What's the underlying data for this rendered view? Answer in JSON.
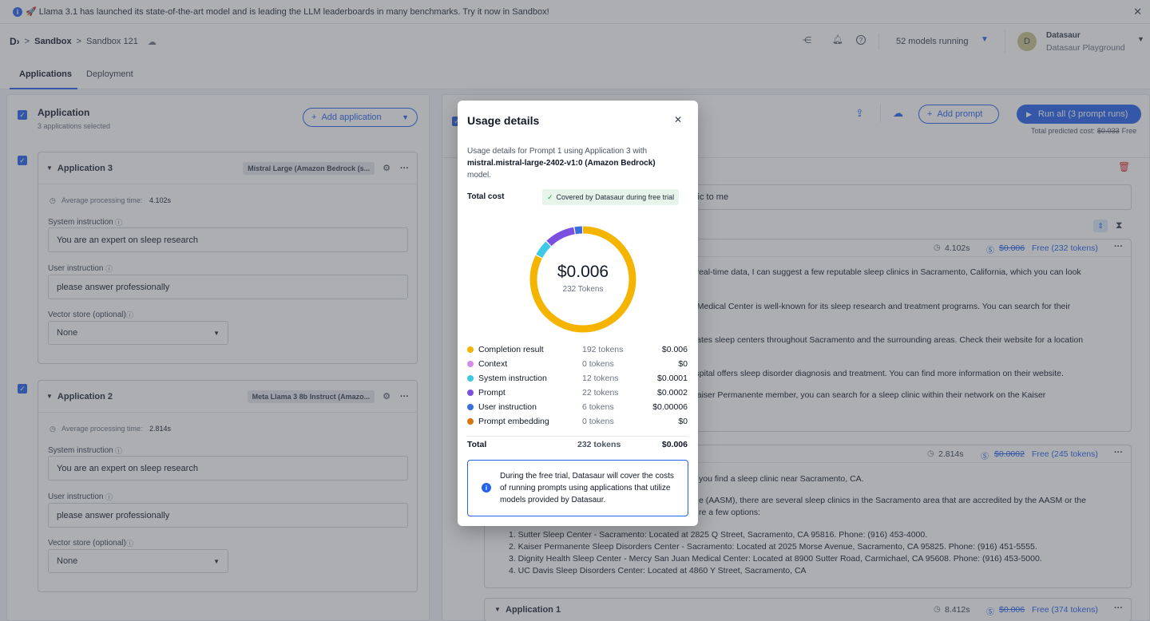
{
  "banner": {
    "icon": "info-icon",
    "text": "🚀 Llama 3.1 has launched its state-of-the-art model and is leading the LLM leaderboards in many benchmarks. Try it now in Sandbox!"
  },
  "breadcrumb": {
    "root": "Sandbox",
    "current": "Sandbox 121"
  },
  "topbar": {
    "models_running": "52 models running",
    "user_initial": "D",
    "user_name": "Datasaur",
    "workspace": "Datasaur Playground"
  },
  "tabs": [
    {
      "label": "Applications"
    },
    {
      "label": "Deployment"
    }
  ],
  "left": {
    "title": "Application",
    "subtitle": "3 applications selected",
    "add_label": "Add application",
    "apps": [
      {
        "name": "Application 3",
        "model": "Mistral Large (Amazon Bedrock (s...",
        "avg_label": "Average processing time:",
        "avg_value": "4.102s",
        "system_label": "System instruction",
        "system_value": "You are an expert on sleep research",
        "user_label": "User instruction",
        "user_value": "please answer professionally",
        "vector_label": "Vector store (optional)",
        "vector_value": "None"
      },
      {
        "name": "Application 2",
        "model": "Meta Llama 3 8b Instruct (Amazo...",
        "avg_label": "Average processing time:",
        "avg_value": "2.814s",
        "system_label": "System instruction",
        "system_value": "You are an expert on sleep research",
        "user_label": "User instruction",
        "user_value": "please answer professionally",
        "vector_label": "Vector store (optional)",
        "vector_value": "None"
      }
    ]
  },
  "right": {
    "add_prompt": "Add prompt",
    "run_all": "Run all (3 prompt runs)",
    "predicted_label": "Total predicted cost:",
    "predicted_old": "$0.033",
    "predicted_new": "Free",
    "prompt_text": "inic to me",
    "r1": {
      "time": "4.102s",
      "old": "$0.006",
      "new": "Free (232 tokens)"
    },
    "r1_lines": [
      "ng real-time data, I can suggest a few reputable sleep clinics in Sacramento, California, which you can look",
      "vis Medical Center is well-known for its sleep research and treatment programs. You can search for their",
      "perates sleep centers throughout Sacramento and the surrounding areas. Check their website for a location",
      "Hospital offers sleep disorder diagnosis and treatment. You can find more information on their website.",
      "a Kaiser Permanente member, you can search for a sleep clinic within their network on the Kaiser"
    ],
    "r2": {
      "time": "2.814s",
      "old": "$0.0002",
      "new": "Free (245 tokens)"
    },
    "r2_lines": [
      "you find a sleep clinic near Sacramento, CA.",
      "e (AASM), there are several sleep clinics in the Sacramento area that are accredited by the AASM or the",
      "re a few options:"
    ],
    "r2_list": [
      "1. Sutter Sleep Center - Sacramento: Located at 2825 Q Street, Sacramento, CA 95816. Phone: (916) 453-4000.",
      "2. Kaiser Permanente Sleep Disorders Center - Sacramento: Located at 2025 Morse Avenue, Sacramento, CA 95825. Phone: (916) 451-5555.",
      "3. Dignity Health Sleep Center - Mercy San Juan Medical Center: Located at 8900 Sutter Road, Carmichael, CA 95608. Phone: (916) 453-5000.",
      "4. UC Davis Sleep Disorders Center: Located at 4860 Y Street, Sacramento, CA"
    ],
    "r3": {
      "name": "Application 1",
      "time": "8.412s",
      "old": "$0.006",
      "new": "Free (374 tokens)"
    }
  },
  "modal": {
    "title": "Usage details",
    "desc_pre": "Usage details for Prompt 1 using Application 3 with",
    "desc_model": "mistral.mistral-large-2402-v1:0 (Amazon Bedrock)",
    "desc_post": "model.",
    "total_cost_label": "Total cost",
    "covered_label": "Covered by Datasaur during free trial",
    "center_value": "$0.006",
    "center_tokens": "232 Tokens",
    "rows": [
      {
        "name": "Completion result",
        "tokens": "192 tokens",
        "cost": "$0.006",
        "color": "#f4b400",
        "count": 192
      },
      {
        "name": "Context",
        "tokens": "0 tokens",
        "cost": "$0",
        "color": "#d58ce8",
        "count": 0
      },
      {
        "name": "System instruction",
        "tokens": "12 tokens",
        "cost": "$0.0001",
        "color": "#3ec9e6",
        "count": 12
      },
      {
        "name": "Prompt",
        "tokens": "22 tokens",
        "cost": "$0.0002",
        "color": "#7b4fe0",
        "count": 22
      },
      {
        "name": "User instruction",
        "tokens": "6 tokens",
        "cost": "$0.00006",
        "color": "#3b6fe0",
        "count": 6
      },
      {
        "name": "Prompt embedding",
        "tokens": "0 tokens",
        "cost": "$0",
        "color": "#d97706",
        "count": 0
      }
    ],
    "total_label": "Total",
    "total_tokens": "232 tokens",
    "total_cost": "$0.006",
    "notice": "During the free trial, Datasaur will cover the costs of running prompts using applications that utilize models provided by Datasaur."
  }
}
